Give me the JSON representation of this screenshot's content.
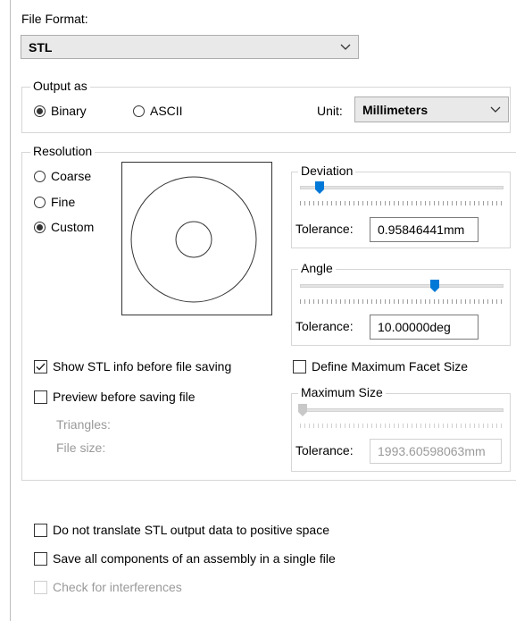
{
  "file_format": {
    "label": "File Format:",
    "value": "STL"
  },
  "output_as": {
    "title": "Output as",
    "binary_label": "Binary",
    "ascii_label": "ASCII",
    "selected": "Binary",
    "unit_label": "Unit:",
    "unit_value": "Millimeters"
  },
  "resolution": {
    "title": "Resolution",
    "options": [
      {
        "label": "Coarse",
        "selected": false
      },
      {
        "label": "Fine",
        "selected": false
      },
      {
        "label": "Custom",
        "selected": true
      }
    ],
    "deviation": {
      "title": "Deviation",
      "tolerance_label": "Tolerance:",
      "tolerance_value": "0.95846441mm",
      "slider_level": 0.08
    },
    "angle": {
      "title": "Angle",
      "tolerance_label": "Tolerance:",
      "tolerance_value": "10.00000deg",
      "slider_level": 0.67
    }
  },
  "options": {
    "show_stl_info": {
      "label": "Show STL info before file saving",
      "checked": true
    },
    "define_max_facet": {
      "label": "Define Maximum Facet Size",
      "checked": false
    },
    "preview_before_saving": {
      "label": "Preview before saving file",
      "checked": false
    },
    "triangles_label": "Triangles:",
    "file_size_label": "File size:"
  },
  "maximum_size": {
    "title": "Maximum Size",
    "tolerance_label": "Tolerance:",
    "tolerance_value": "1993.60598063mm",
    "slider_level": 0.0
  },
  "bottom_options": {
    "no_translate": {
      "label": "Do not translate STL output data to positive space",
      "checked": false
    },
    "single_file": {
      "label": "Save all components of an assembly in a single file",
      "checked": false
    },
    "interferences": {
      "label": "Check for interferences",
      "checked": false,
      "disabled": true
    }
  },
  "colors": {
    "accent": "#0078d7",
    "disabled_text": "#9a9a9a"
  }
}
